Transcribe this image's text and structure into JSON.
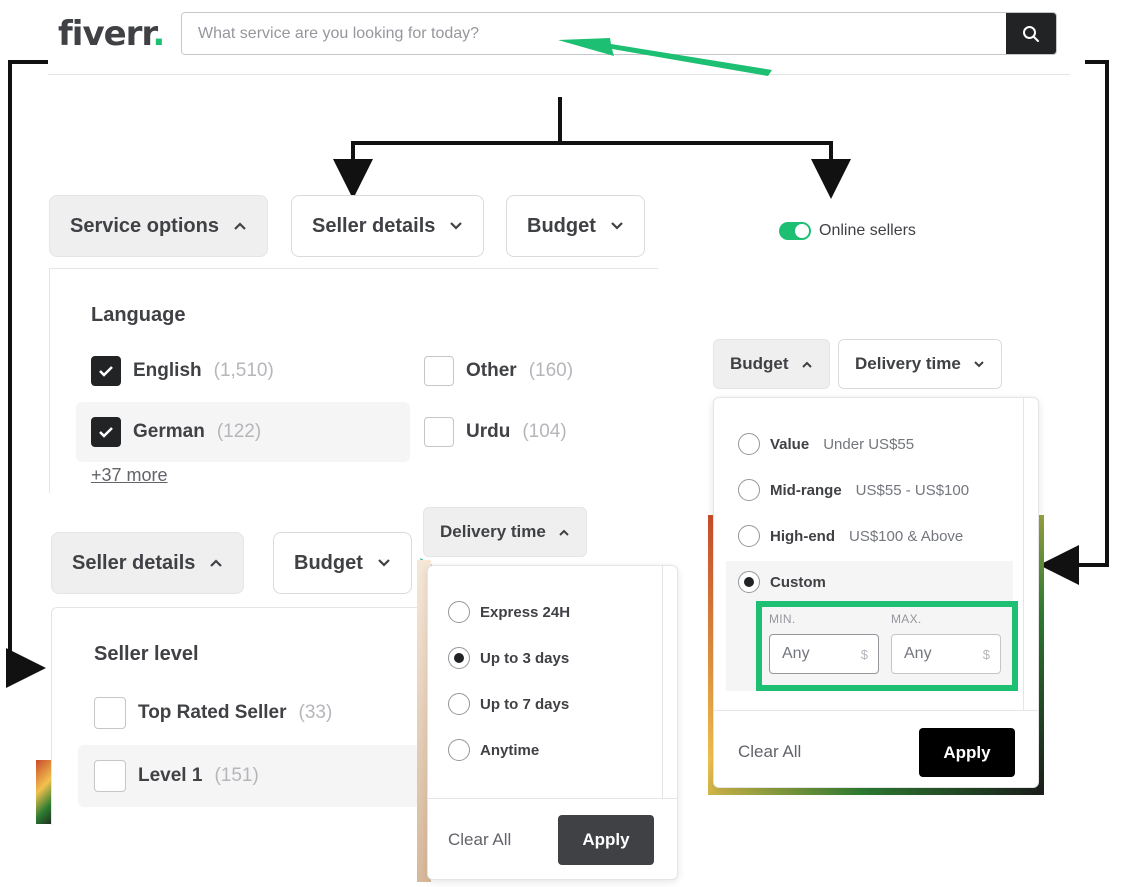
{
  "header": {
    "logo_text": "fiverr",
    "logo_dot": ".",
    "search_placeholder": "What service are you looking for today?"
  },
  "colors": {
    "brand_green": "#1dbf73",
    "dark": "#222325",
    "highlight": "#1dbf73"
  },
  "top_filters": {
    "service_options": "Service options",
    "seller_details": "Seller details",
    "budget": "Budget",
    "online_sellers": "Online sellers"
  },
  "language_panel": {
    "title": "Language",
    "items": [
      {
        "label": "English",
        "count": "(1,510)",
        "checked": true
      },
      {
        "label": "Other",
        "count": "(160)",
        "checked": false
      },
      {
        "label": "German",
        "count": "(122)",
        "checked": true
      },
      {
        "label": "Urdu",
        "count": "(104)",
        "checked": false
      }
    ],
    "more_link": "+37 more"
  },
  "seller_filters": {
    "seller_details": "Seller details",
    "budget": "Budget",
    "delivery_time": "Delivery time"
  },
  "seller_level_panel": {
    "title": "Seller level",
    "items": [
      {
        "label": "Top Rated Seller",
        "count": "(33)"
      },
      {
        "label": "Level 1",
        "count": "(151)"
      }
    ]
  },
  "delivery_panel": {
    "options": [
      {
        "label": "Express 24H",
        "selected": false
      },
      {
        "label": "Up to 3 days",
        "selected": true
      },
      {
        "label": "Up to 7 days",
        "selected": false
      },
      {
        "label": "Anytime",
        "selected": false
      }
    ],
    "clear_label": "Clear All",
    "apply_label": "Apply"
  },
  "budget_filters": {
    "budget": "Budget",
    "delivery_time": "Delivery time"
  },
  "budget_panel": {
    "options": [
      {
        "label": "Value",
        "sub": "Under US$55",
        "selected": false
      },
      {
        "label": "Mid-range",
        "sub": "US$55 - US$100",
        "selected": false
      },
      {
        "label": "High-end",
        "sub": "US$100 & Above",
        "selected": false
      },
      {
        "label": "Custom",
        "sub": "",
        "selected": true
      }
    ],
    "min_label": "MIN.",
    "max_label": "MAX.",
    "min_value": "Any",
    "max_value": "Any",
    "currency": "$",
    "clear_label": "Clear All",
    "apply_label": "Apply"
  }
}
